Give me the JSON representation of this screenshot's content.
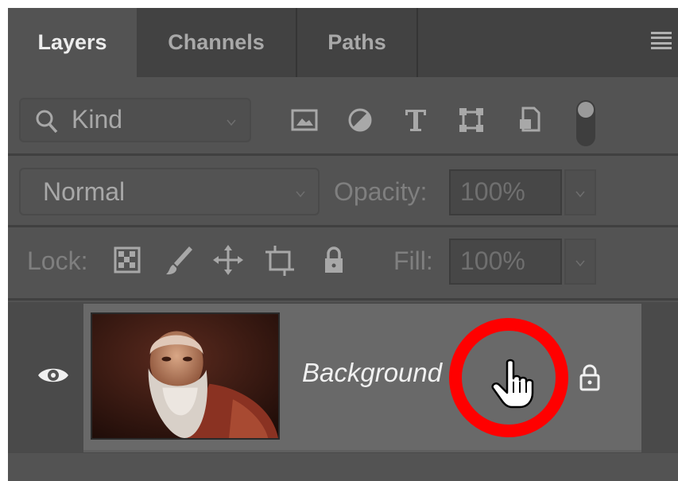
{
  "tabs": [
    {
      "label": "Layers",
      "active": true
    },
    {
      "label": "Channels",
      "active": false
    },
    {
      "label": "Paths",
      "active": false
    }
  ],
  "filter": {
    "kind_label": "Kind",
    "icons": [
      "pixel-layer-filter-icon",
      "adjustment-layer-filter-icon",
      "type-layer-filter-icon",
      "shape-layer-filter-icon",
      "smart-object-filter-icon"
    ]
  },
  "blend": {
    "mode_label": "Normal",
    "opacity_label": "Opacity:",
    "opacity_value": "100%"
  },
  "lock": {
    "label": "Lock:",
    "icons": [
      "lock-transparent-pixels-icon",
      "lock-image-pixels-icon",
      "lock-position-icon",
      "lock-artboard-icon",
      "lock-all-icon"
    ],
    "fill_label": "Fill:",
    "fill_value": "100%"
  },
  "layer": {
    "name": "Background",
    "visible": true,
    "locked": true
  },
  "colors": {
    "panel": "#535353",
    "tabbar": "#424242",
    "layer_selected": "#696969",
    "highlight_ring": "#ff0000"
  }
}
